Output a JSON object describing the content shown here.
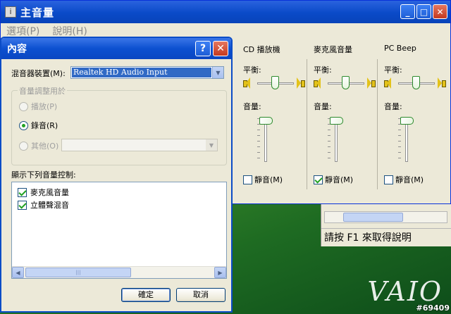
{
  "main_window": {
    "title": "主音量",
    "menu": [
      {
        "label": "選項(P)"
      },
      {
        "label": "說明(H)"
      }
    ],
    "caption_buttons": {
      "minimize": "_",
      "maximize": "□",
      "close": "✕"
    },
    "channels": [
      {
        "name": "CD 播放機",
        "balance_label": "平衡:",
        "volume_label": "音量:",
        "mute_label": "靜音(M)",
        "muted": false
      },
      {
        "name": "麥克風音量",
        "balance_label": "平衡:",
        "volume_label": "音量:",
        "mute_label": "靜音(M)",
        "muted": true
      },
      {
        "name": "PC Beep",
        "balance_label": "平衡:",
        "volume_label": "音量:",
        "mute_label": "靜音(M)",
        "muted": false
      }
    ],
    "status_text": "請按 F1 來取得說明"
  },
  "dialog": {
    "title": "內容",
    "help_button": "?",
    "close_button": "✕",
    "mixer_device_label": "混音器裝置(M):",
    "mixer_device_value": "Realtek HD Audio Input",
    "adjust_group_label": "音量調整用於",
    "radio_options": [
      {
        "label": "播放(P)",
        "selected": false,
        "disabled": true
      },
      {
        "label": "錄音(R)",
        "selected": true,
        "disabled": false
      },
      {
        "label": "其他(O)",
        "selected": false,
        "disabled": true
      }
    ],
    "show_controls_label": "顯示下列音量控制:",
    "controls": [
      {
        "label": "麥克風音量",
        "checked": true
      },
      {
        "label": "立體聲混音",
        "checked": true
      }
    ],
    "ok_button": "確定",
    "cancel_button": "取消"
  },
  "desktop": {
    "logo_text": "VAIO",
    "watermark": "#69409"
  },
  "colors": {
    "titlebar_blue": "#0a4ac8",
    "window_bg": "#ece9d8",
    "check_green": "#21a121",
    "selection_blue": "#316ac5"
  }
}
